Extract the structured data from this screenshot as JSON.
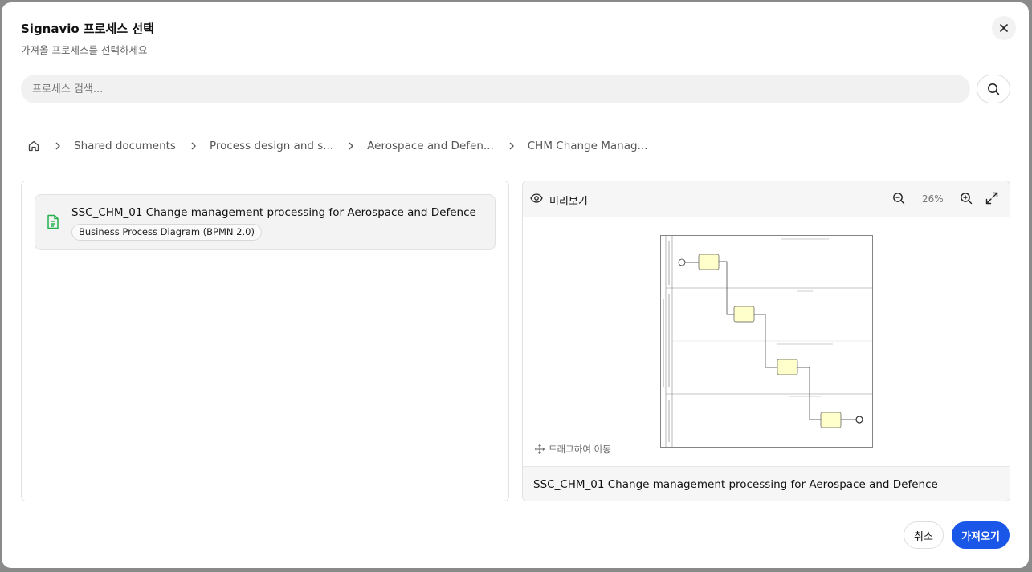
{
  "dialog": {
    "title": "Signavio 프로세스 선택",
    "subtitle": "가져올 프로세스를 선택하세요"
  },
  "search": {
    "placeholder": "프로세스 검색..."
  },
  "breadcrumb": [
    "Shared documents",
    "Process design and s...",
    "Aerospace and Defen...",
    "CHM Change Manag..."
  ],
  "file": {
    "name": "SSC_CHM_01 Change management processing for Aerospace and Defence",
    "type": "Business Process Diagram (BPMN 2.0)"
  },
  "preview": {
    "label": "미리보기",
    "zoom": "26%",
    "drag_hint": "드래그하여 이동",
    "title": "SSC_CHM_01 Change management processing for Aerospace and Defence"
  },
  "actions": {
    "cancel": "취소",
    "import": "가져오기"
  },
  "colors": {
    "primary": "#1a56e8",
    "file_icon": "#22b14c",
    "task_fill": "#ffffcc"
  }
}
